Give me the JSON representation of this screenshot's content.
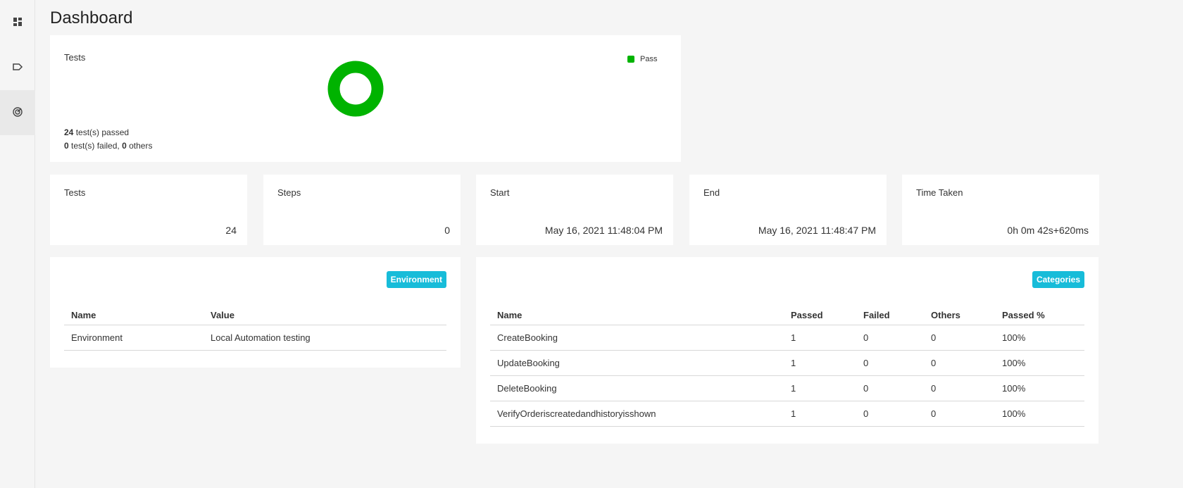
{
  "page_title": "Dashboard",
  "sidebar": {
    "items": [
      {
        "icon": "dashboard-icon"
      },
      {
        "icon": "tag-icon"
      },
      {
        "icon": "radar-icon",
        "active": true
      }
    ]
  },
  "tests_chart": {
    "title": "Tests",
    "legend_label": "Pass",
    "pass_color": "#00b300",
    "summary": {
      "passed_count": "24",
      "passed_text": "test(s) passed",
      "failed_count": "0",
      "failed_text": "test(s) failed,",
      "others_count": "0",
      "others_text": "others"
    }
  },
  "stats": [
    {
      "label": "Tests",
      "value": "24"
    },
    {
      "label": "Steps",
      "value": "0"
    },
    {
      "label": "Start",
      "value": "May 16, 2021 11:48:04 PM"
    },
    {
      "label": "End",
      "value": "May 16, 2021 11:48:47 PM"
    },
    {
      "label": "Time Taken",
      "value": "0h 0m 42s+620ms"
    }
  ],
  "environment": {
    "badge": "Environment",
    "headers": [
      "Name",
      "Value"
    ],
    "rows": [
      [
        "Environment",
        "Local Automation testing"
      ]
    ]
  },
  "categories": {
    "badge": "Categories",
    "headers": [
      "Name",
      "Passed",
      "Failed",
      "Others",
      "Passed %"
    ],
    "rows": [
      [
        "CreateBooking",
        "1",
        "0",
        "0",
        "100%"
      ],
      [
        "UpdateBooking",
        "1",
        "0",
        "0",
        "100%"
      ],
      [
        "DeleteBooking",
        "1",
        "0",
        "0",
        "100%"
      ],
      [
        "VerifyOrderiscreatedandhistoryisshown",
        "1",
        "0",
        "0",
        "100%"
      ]
    ]
  },
  "colors": {
    "accent": "#17bcd9",
    "pass": "#00b300"
  }
}
